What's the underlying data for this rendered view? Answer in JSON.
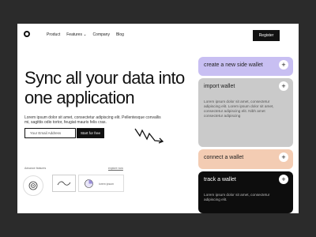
{
  "nav": {
    "items": [
      "Product",
      "Features ⌄",
      "Company",
      "Blog"
    ],
    "register": "Register"
  },
  "hero": {
    "headline": "Sync all your data into one application",
    "subtext": "Lorem ipsum dolor sit amet, consectetur adipiscing elit. Pellentesque convallis mi, sagittis odio tortor, feugiat mauris felis cras.",
    "email_placeholder": "Your Email Address",
    "cta": "Start for free"
  },
  "features": {
    "label": "Advance features",
    "link": "explore now",
    "box_text": "lorem ipsum"
  },
  "cards": [
    {
      "title": "create a new side wallet",
      "desc": ""
    },
    {
      "title": "import wallet",
      "desc": "Lorem ipsum dolor sit amet, consectetur adipiscing elit. Lorem ipsum dolor sit amet, consectetur adipiscing elit. Nibh amet consectetur adipiscing"
    },
    {
      "title": "connect a wallet",
      "desc": ""
    },
    {
      "title": "track a wallet",
      "desc": "Lorem ipsum dolor sit amet, consectetur adipiscing elit."
    }
  ],
  "colors": {
    "card_purple": "#c8bff2",
    "card_gray": "#cacaca",
    "card_peach": "#f3ccb3",
    "card_black": "#0d0d0d"
  }
}
